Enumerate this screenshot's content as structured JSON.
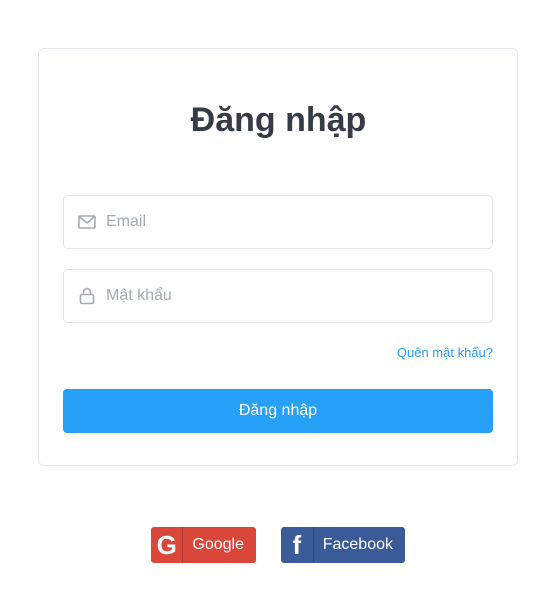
{
  "login": {
    "title": "Đăng nhập",
    "email_placeholder": "Email",
    "password_placeholder": "Mật khẩu",
    "forgot_label": "Quên mật khẩu?",
    "submit_label": "Đăng nhập"
  },
  "social": {
    "google_label": "Google",
    "google_icon": "G",
    "facebook_label": "Facebook",
    "facebook_icon": "f"
  },
  "colors": {
    "accent": "#27a0f8",
    "google": "#d9473a",
    "facebook": "#3a5a98",
    "title": "#353c47"
  }
}
